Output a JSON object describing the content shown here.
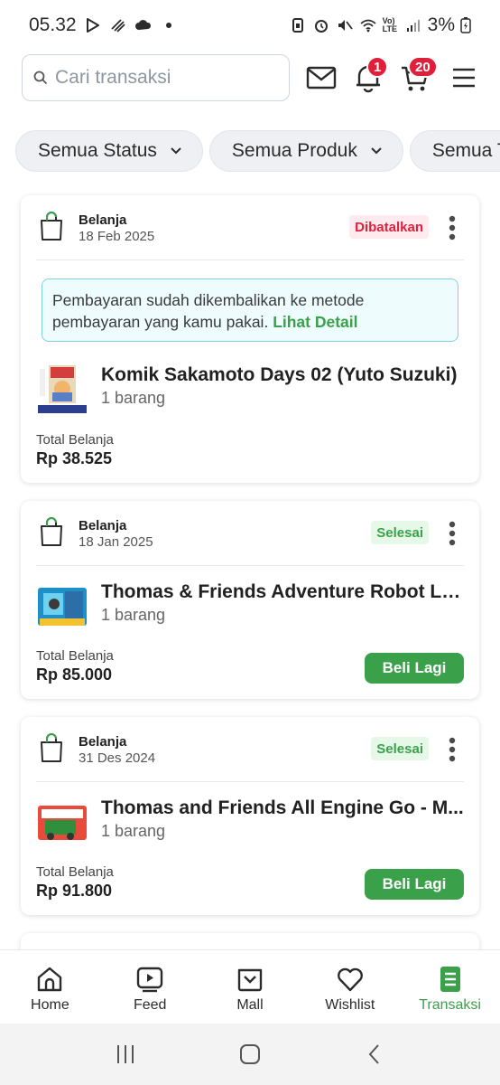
{
  "status_bar": {
    "time": "05.32",
    "battery": "3%",
    "network_label": "Vo) LTE"
  },
  "search": {
    "placeholder": "Cari transaksi"
  },
  "header": {
    "notification_count": "1",
    "cart_count": "20"
  },
  "filters": [
    {
      "label": "Semua Status"
    },
    {
      "label": "Semua Produk"
    },
    {
      "label": "Semua Tanggal"
    }
  ],
  "transactions": [
    {
      "type": "Belanja",
      "date": "18 Feb 2025",
      "status": "Dibatalkan",
      "notice_text": "Pembayaran sudah dikembalikan ke metode pembayaran yang kamu pakai.",
      "notice_link": "Lihat Detail",
      "product_name": "Komik Sakamoto Days 02 (Yuto Suzuki)",
      "quantity": "1 barang",
      "total_label": "Total Belanja",
      "total": "Rp 38.525"
    },
    {
      "type": "Belanja",
      "date": "18 Jan 2025",
      "status": "Selesai",
      "product_name": "Thomas & Friends Adventure Robot La...",
      "quantity": "1 barang",
      "total_label": "Total Belanja",
      "total": "Rp 85.000",
      "button": "Beli Lagi"
    },
    {
      "type": "Belanja",
      "date": "31 Des 2024",
      "status": "Selesai",
      "product_name": "Thomas and Friends All Engine Go - M...",
      "quantity": "1 barang",
      "total_label": "Total Belanja",
      "total": "Rp 91.800",
      "button": "Beli Lagi"
    }
  ],
  "bottom_nav": [
    {
      "label": "Home",
      "icon": "home-icon"
    },
    {
      "label": "Feed",
      "icon": "play-icon"
    },
    {
      "label": "Mall",
      "icon": "mall-icon"
    },
    {
      "label": "Wishlist",
      "icon": "heart-icon"
    },
    {
      "label": "Transaksi",
      "icon": "receipt-icon",
      "active": true
    }
  ],
  "colors": {
    "accent_green": "#3aa14a",
    "badge_red": "#e0203a",
    "notice_bg": "#eefcfd"
  }
}
